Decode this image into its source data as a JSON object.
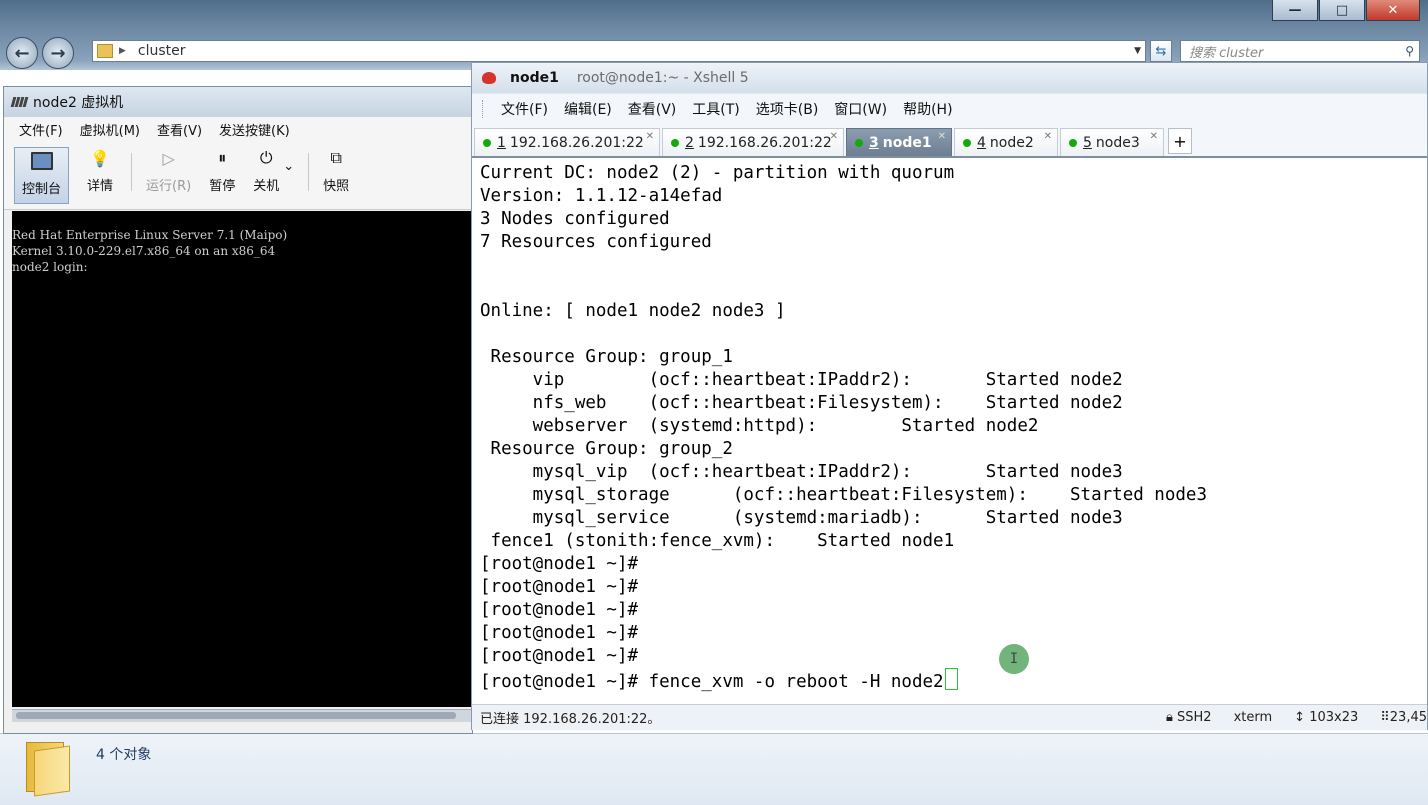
{
  "explorer": {
    "window_controls": {
      "minimize": "—",
      "maximize": "□",
      "close": "✕"
    },
    "address": "cluster",
    "search_placeholder": "搜索 cluster",
    "status_text": "4 个对象"
  },
  "vm_window": {
    "title": "node2 虚拟机",
    "menu": [
      "文件(F)",
      "虚拟机(M)",
      "查看(V)",
      "发送按键(K)"
    ],
    "toolbar": {
      "console": "控制台",
      "details": "详情",
      "run": "运行(R)",
      "pause": "暂停",
      "shutdown": "关机",
      "snapshot": "快照"
    },
    "console_lines": [
      "Red Hat Enterprise Linux Server 7.1 (Maipo)",
      "Kernel 3.10.0-229.el7.x86_64 on an x86_64",
      "",
      "node2 login:"
    ]
  },
  "xshell": {
    "title": "node1",
    "subtitle": "root@node1:~ - Xshell 5",
    "menu": [
      "文件(F)",
      "编辑(E)",
      "查看(V)",
      "工具(T)",
      "选项卡(B)",
      "窗口(W)",
      "帮助(H)"
    ],
    "tabs": [
      {
        "num": "1",
        "label": "192.168.26.201:22",
        "active": false
      },
      {
        "num": "2",
        "label": "192.168.26.201:22",
        "active": false
      },
      {
        "num": "3",
        "label": "node1",
        "active": true
      },
      {
        "num": "4",
        "label": "node2",
        "active": false
      },
      {
        "num": "5",
        "label": "node3",
        "active": false
      }
    ],
    "tab_add": "+",
    "terminal_lines": [
      "Current DC: node2 (2) - partition with quorum",
      "Version: 1.1.12-a14efad",
      "3 Nodes configured",
      "7 Resources configured",
      "",
      "",
      "Online: [ node1 node2 node3 ]",
      "",
      " Resource Group: group_1",
      "     vip        (ocf::heartbeat:IPaddr2):       Started node2",
      "     nfs_web    (ocf::heartbeat:Filesystem):    Started node2",
      "     webserver  (systemd:httpd):        Started node2",
      " Resource Group: group_2",
      "     mysql_vip  (ocf::heartbeat:IPaddr2):       Started node3",
      "     mysql_storage      (ocf::heartbeat:Filesystem):    Started node3",
      "     mysql_service      (systemd:mariadb):      Started node3",
      " fence1 (stonith:fence_xvm):    Started node1",
      "[root@node1 ~]#",
      "[root@node1 ~]#",
      "[root@node1 ~]#",
      "[root@node1 ~]#",
      "[root@node1 ~]#"
    ],
    "current_command": "[root@node1 ~]# fence_xvm -o reboot -H node2",
    "status": {
      "connection": "已连接 192.168.26.201:22。",
      "protocol": "SSH2",
      "term": "xterm",
      "size": "103x23",
      "position": "23,45"
    },
    "colors": {
      "active_tab": "#7a8a9e",
      "connected_dot": "#17a80d",
      "cursor": "#28c92a"
    }
  }
}
